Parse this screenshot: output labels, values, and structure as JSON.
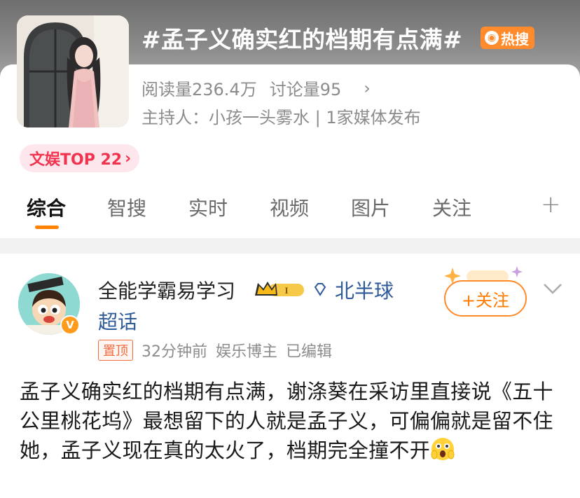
{
  "topic": {
    "title": "#孟子义确实红的档期有点满#",
    "hot_label": "热搜",
    "stats": {
      "reads": "阅读量236.4万",
      "discussions": "讨论量95"
    },
    "host_line": "主持人：小孩一头雾水 | 1家媒体发布",
    "rank_label": "文娱TOP 22"
  },
  "tabs": [
    {
      "label": "综合",
      "active": true
    },
    {
      "label": "智搜"
    },
    {
      "label": "实时"
    },
    {
      "label": "视频"
    },
    {
      "label": "图片"
    },
    {
      "label": "关注"
    }
  ],
  "post": {
    "username": "全能学霸易学习",
    "location": "北半球",
    "supertopic": "超话",
    "follow_label": "+关注",
    "pinned_label": "置顶",
    "time": "32分钟前",
    "role": "娱乐博主",
    "edited": "已编辑",
    "content": "孟子义确实红的档期有点满，谢涤葵在采访里直接说《五十公里桃花坞》最想留下的人就是孟子义，可偏偏就是留不住她，孟子义现在真的太火了，档期完全撞不开"
  },
  "colors": {
    "accent": "#ff8200",
    "link_blue": "#2f5a9a",
    "hot_orange": "#ff8b2c",
    "rank_red": "#f0334f"
  },
  "icons": [
    "fire-icon",
    "chevron-right-icon",
    "plus-icon",
    "crown-level-icon",
    "diamond-icon",
    "verified-icon",
    "chevron-down-icon",
    "shocked-emoji-icon"
  ]
}
